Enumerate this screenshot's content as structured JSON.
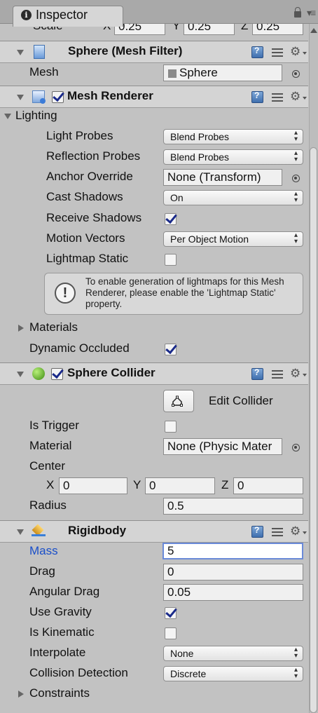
{
  "window": {
    "tab_title": "Inspector"
  },
  "transform_partial": {
    "scale_label": "Scale",
    "x_label": "X",
    "x_value": "0.25",
    "y_label": "Y",
    "y_value": "0.25",
    "z_label": "Z",
    "z_value": "0.25"
  },
  "mesh_filter": {
    "title": "Sphere (Mesh Filter)",
    "mesh_label": "Mesh",
    "mesh_value": "Sphere"
  },
  "mesh_renderer": {
    "title": "Mesh Renderer",
    "enabled": true,
    "lighting_label": "Lighting",
    "light_probes_label": "Light Probes",
    "light_probes_value": "Blend Probes",
    "reflection_probes_label": "Reflection Probes",
    "reflection_probes_value": "Blend Probes",
    "anchor_override_label": "Anchor Override",
    "anchor_override_value": "None (Transform)",
    "cast_shadows_label": "Cast Shadows",
    "cast_shadows_value": "On",
    "receive_shadows_label": "Receive Shadows",
    "receive_shadows": true,
    "motion_vectors_label": "Motion Vectors",
    "motion_vectors_value": "Per Object Motion",
    "lightmap_static_label": "Lightmap Static",
    "lightmap_static": false,
    "help_text": "To enable generation of lightmaps for this Mesh Renderer, please enable the 'Lightmap Static' property.",
    "materials_label": "Materials",
    "dynamic_occluded_label": "Dynamic Occluded",
    "dynamic_occluded": true
  },
  "sphere_collider": {
    "title": "Sphere Collider",
    "enabled": true,
    "edit_collider_label": "Edit Collider",
    "is_trigger_label": "Is Trigger",
    "is_trigger": false,
    "material_label": "Material",
    "material_value": "None (Physic Mater",
    "center_label": "Center",
    "center_x_label": "X",
    "center_x": "0",
    "center_y_label": "Y",
    "center_y": "0",
    "center_z_label": "Z",
    "center_z": "0",
    "radius_label": "Radius",
    "radius_value": "0.5"
  },
  "rigidbody": {
    "title": "Rigidbody",
    "mass_label": "Mass",
    "mass_value": "5",
    "drag_label": "Drag",
    "drag_value": "0",
    "angular_drag_label": "Angular Drag",
    "angular_drag_value": "0.05",
    "use_gravity_label": "Use Gravity",
    "use_gravity": true,
    "is_kinematic_label": "Is Kinematic",
    "is_kinematic": false,
    "interpolate_label": "Interpolate",
    "interpolate_value": "None",
    "collision_detection_label": "Collision Detection",
    "collision_detection_value": "Discrete",
    "constraints_label": "Constraints"
  },
  "colors": {
    "panel_bg": "#c2c2c2",
    "header_bg": "#d4d4d4",
    "active_field_border": "#6a8ad8",
    "mass_label_color": "#1a4fc9"
  }
}
